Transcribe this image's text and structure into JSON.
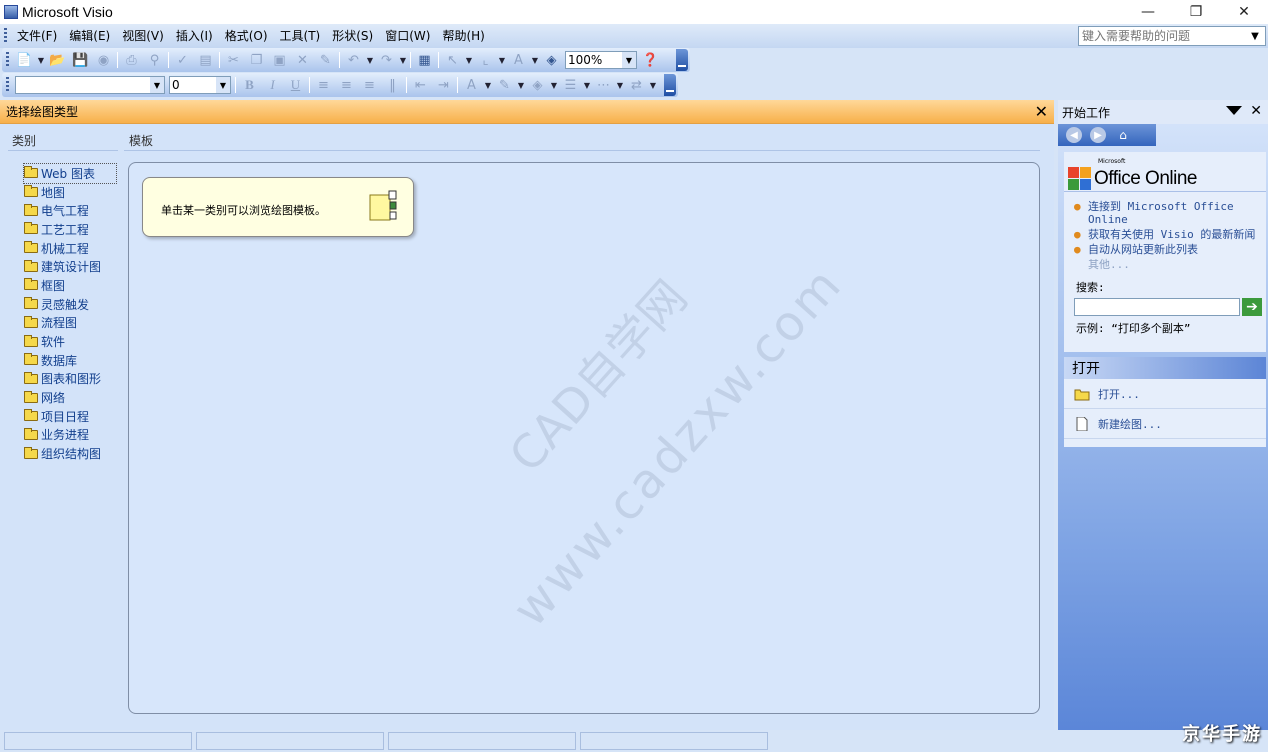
{
  "window": {
    "title": "Microsoft Visio"
  },
  "menubar": {
    "items": [
      "文件(F)",
      "编辑(E)",
      "视图(V)",
      "插入(I)",
      "格式(O)",
      "工具(T)",
      "形状(S)",
      "窗口(W)",
      "帮助(H)"
    ],
    "help_placeholder": "键入需要帮助的问题"
  },
  "toolbar": {
    "zoom": "100%",
    "font_size": "0"
  },
  "panel": {
    "title": "选择绘图类型",
    "category_header": "类别",
    "template_header": "模板",
    "categories": [
      "Web 图表",
      "地图",
      "电气工程",
      "工艺工程",
      "机械工程",
      "建筑设计图",
      "框图",
      "灵感触发",
      "流程图",
      "软件",
      "数据库",
      "图表和图形",
      "网络",
      "项目日程",
      "业务进程",
      "组织结构图"
    ],
    "tip": "单击某一类别可以浏览绘图模板。"
  },
  "taskpane": {
    "title": "开始工作",
    "brand": "Office Online",
    "brand_prefix": "Microsoft",
    "links": [
      "连接到 Microsoft Office Online",
      "获取有关使用 Visio 的最新新闻",
      "自动从网站更新此列表"
    ],
    "more": "其他...",
    "search_label": "搜索:",
    "example": "示例: “打印多个副本”",
    "open_header": "打开",
    "open_items": [
      "打开...",
      "新建绘图..."
    ]
  },
  "watermark": {
    "line1": "CAD自学网",
    "line2": "www.cadzxw.com",
    "corner": "京华手游"
  },
  "colors": {
    "panel_header": "#f7b04a",
    "workspace": "#d3e3f9",
    "taskpane": "#5b86d8",
    "link": "#2a4f96",
    "bullet": "#e08a1e"
  }
}
